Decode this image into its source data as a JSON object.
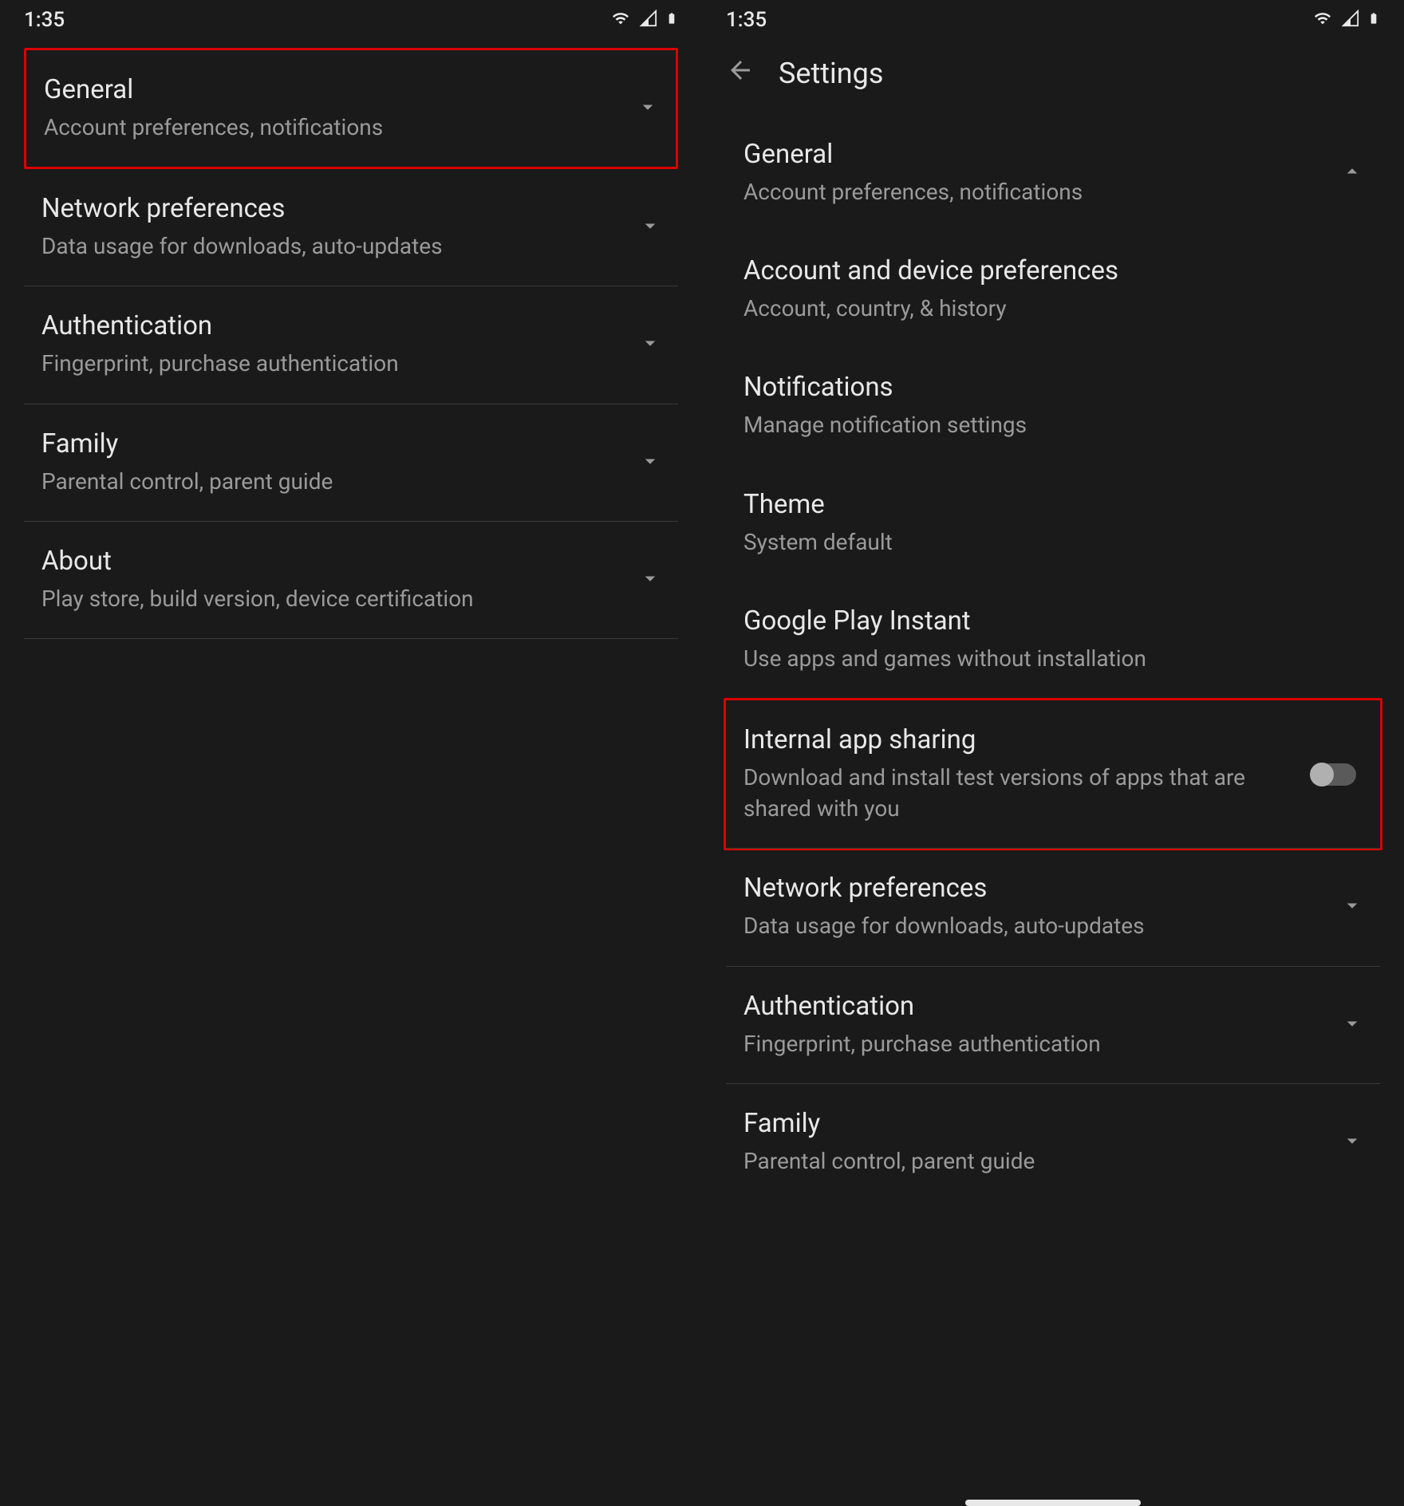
{
  "status": {
    "time": "1:35"
  },
  "left": {
    "items": [
      {
        "title": "General",
        "subtitle": "Account preferences, notifications"
      },
      {
        "title": "Network preferences",
        "subtitle": "Data usage for downloads, auto-updates"
      },
      {
        "title": "Authentication",
        "subtitle": "Fingerprint, purchase authentication"
      },
      {
        "title": "Family",
        "subtitle": "Parental control, parent guide"
      },
      {
        "title": "About",
        "subtitle": "Play store, build version, device certification"
      }
    ]
  },
  "right": {
    "header_title": "Settings",
    "items": [
      {
        "title": "General",
        "subtitle": "Account preferences, notifications"
      },
      {
        "title": "Account and device preferences",
        "subtitle": "Account, country, & history"
      },
      {
        "title": "Notifications",
        "subtitle": "Manage notification settings"
      },
      {
        "title": "Theme",
        "subtitle": "System default"
      },
      {
        "title": "Google Play Instant",
        "subtitle": "Use apps and games without installation"
      },
      {
        "title": "Internal app sharing",
        "subtitle": "Download and install test versions of apps that are shared with you"
      },
      {
        "title": "Network preferences",
        "subtitle": "Data usage for downloads, auto-updates"
      },
      {
        "title": "Authentication",
        "subtitle": "Fingerprint, purchase authentication"
      },
      {
        "title": "Family",
        "subtitle": "Parental control, parent guide"
      }
    ]
  }
}
